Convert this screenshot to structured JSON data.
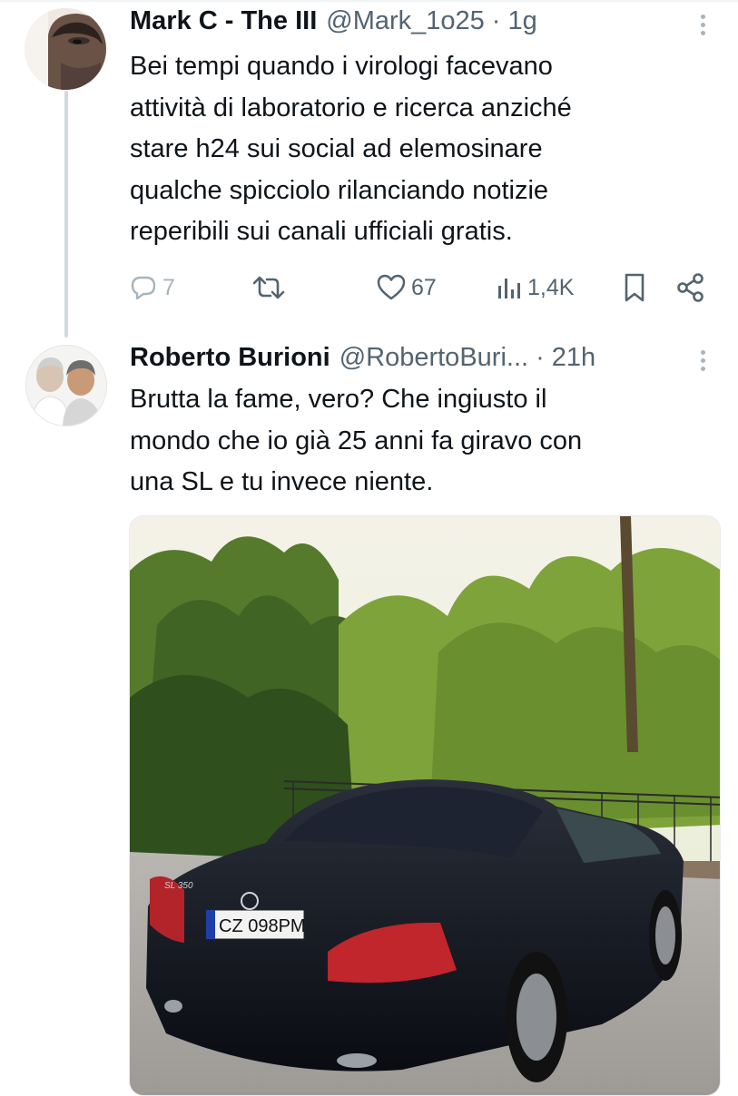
{
  "tweets": [
    {
      "display_name": "Mark C - The III",
      "handle": "@Mark_1o25",
      "separator": "·",
      "time": "1g",
      "text_lines": [
        "Bei tempi quando i virologi facevano",
        "attività di laboratorio e ricerca anziché",
        "stare h24 sui social ad elemosinare",
        "qualche spicciolo rilanciando notizie",
        "reperibili sui canali ufficiali gratis."
      ],
      "actions": {
        "reply_count": "7",
        "like_count": "67",
        "views_count": "1,4K"
      }
    },
    {
      "display_name": "Roberto Burioni",
      "handle": "@RobertoBuri...",
      "separator": "·",
      "time": "21h",
      "text_lines": [
        "Brutta la fame, vero? Che ingiusto il",
        "mondo che io già 25 anni fa giravo con",
        "una SL e tu invece niente."
      ],
      "media": {
        "car_badge": "SL 350",
        "license_plate": "CZ 098PM"
      }
    }
  ],
  "icons": {
    "reply": "reply-icon",
    "retweet": "retweet-icon",
    "like": "heart-icon",
    "views": "views-icon",
    "bookmark": "bookmark-icon",
    "share": "share-icon",
    "more": "more-vertical-icon"
  },
  "colors": {
    "text": "#0f1419",
    "secondary": "#536471",
    "thread_line": "#cfd9de"
  }
}
